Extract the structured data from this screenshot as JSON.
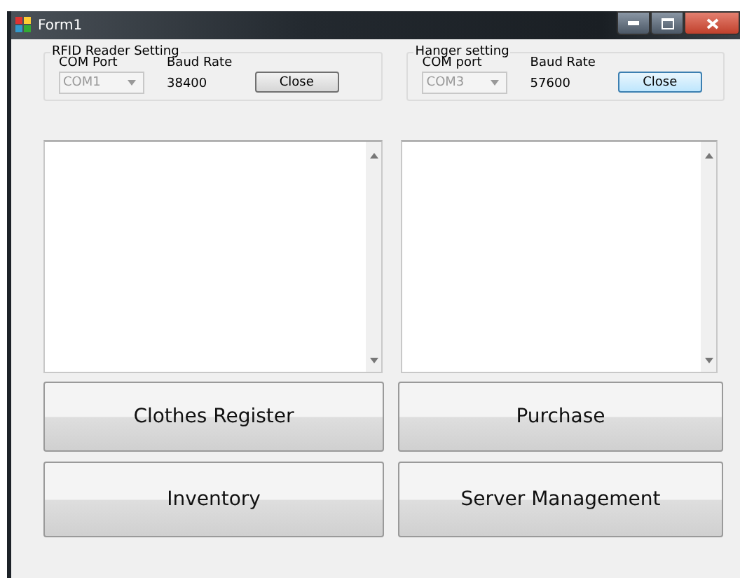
{
  "window": {
    "title": "Form1"
  },
  "groups": [
    {
      "title": "RFID Reader Setting",
      "port_label": "COM Port",
      "port": {
        "value": "COM1",
        "disabled": true
      },
      "baud_label": "Baud Rate",
      "baud": "38400",
      "button": {
        "label": "Close",
        "focused": false
      }
    },
    {
      "title": "Hanger setting",
      "port_label": "COM port",
      "port": {
        "value": "COM3",
        "disabled": true
      },
      "baud_label": "Baud Rate",
      "baud": "57600",
      "button": {
        "label": "Close",
        "focused": true
      }
    }
  ],
  "text_areas": [
    {
      "kind": "textbox"
    },
    {
      "kind": "textbox"
    }
  ],
  "buttons": [
    "Clothes Register",
    "Purchase",
    "Inventory",
    "Server Management"
  ]
}
